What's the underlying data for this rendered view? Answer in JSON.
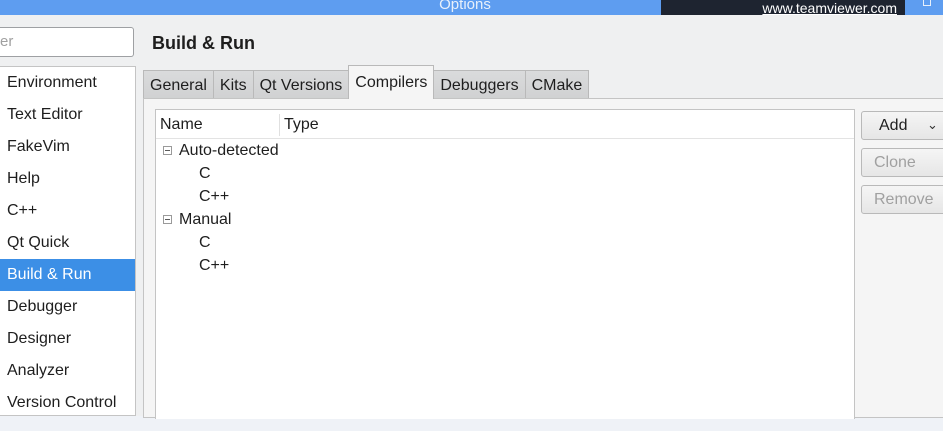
{
  "window": {
    "title": "Options",
    "teamviewer_link": "www.teamviewer.com"
  },
  "filter": {
    "placeholder_fragment": "er"
  },
  "sidebar": {
    "items": [
      {
        "label": "Environment"
      },
      {
        "label": "Text Editor"
      },
      {
        "label": "FakeVim"
      },
      {
        "label": "Help"
      },
      {
        "label": "C++"
      },
      {
        "label": "Qt Quick"
      },
      {
        "label": "Build & Run",
        "active": true
      },
      {
        "label": "Debugger"
      },
      {
        "label": "Designer"
      },
      {
        "label": "Analyzer"
      },
      {
        "label": "Version Control"
      }
    ]
  },
  "page": {
    "title": "Build & Run"
  },
  "tabs": [
    {
      "label": "General"
    },
    {
      "label": "Kits"
    },
    {
      "label": "Qt Versions"
    },
    {
      "label": "Compilers",
      "active": true
    },
    {
      "label": "Debuggers"
    },
    {
      "label": "CMake"
    }
  ],
  "tree": {
    "columns": [
      "Name",
      "Type"
    ],
    "groups": [
      {
        "label": "Auto-detected",
        "children": [
          "C",
          "C++"
        ]
      },
      {
        "label": "Manual",
        "children": [
          "C",
          "C++"
        ]
      }
    ]
  },
  "buttons": {
    "add": "Add",
    "clone": "Clone",
    "remove": "Remove"
  },
  "colors": {
    "accent": "#3c8fe6",
    "titlebar": "#5e9df0"
  }
}
